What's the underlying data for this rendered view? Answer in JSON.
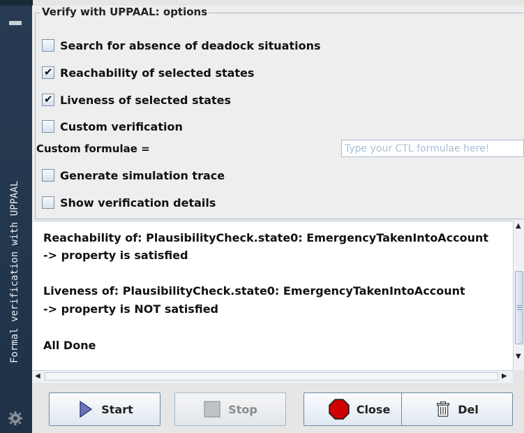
{
  "sidebar": {
    "title": "Formal verification with UPPAAL",
    "minimize_icon": "minimize-icon",
    "bottom_icon": "gear-icon"
  },
  "options": {
    "legend": "Verify with UPPAAL: options",
    "items": [
      {
        "label": "Search for absence of deadock situations",
        "checked": false
      },
      {
        "label": "Reachability of selected states",
        "checked": true
      },
      {
        "label": "Liveness of selected states",
        "checked": true
      },
      {
        "label": "Custom verification",
        "checked": false
      }
    ],
    "custom_formulae_label": "Custom formulae =",
    "custom_formulae_value": "",
    "custom_formulae_placeholder": "Type your CTL formulae here!",
    "items_after": [
      {
        "label": "Generate simulation trace",
        "checked": false
      },
      {
        "label": "Show verification details",
        "checked": false
      }
    ]
  },
  "output": {
    "lines": [
      "Reachability of: PlausibilityCheck.state0: EmergencyTakenIntoAccount",
      "-> property is satisfied",
      "Liveness of: PlausibilityCheck.state0: EmergencyTakenIntoAccount",
      "-> property is NOT satisfied",
      "All Done"
    ]
  },
  "buttons": {
    "start": "Start",
    "stop": "Stop",
    "close": "Close",
    "del": "Del"
  },
  "colors": {
    "sidebar": "#263b52",
    "accent_border": "#a8b8c8",
    "close_icon": "#d10000",
    "start_icon": "#6a72b8"
  }
}
